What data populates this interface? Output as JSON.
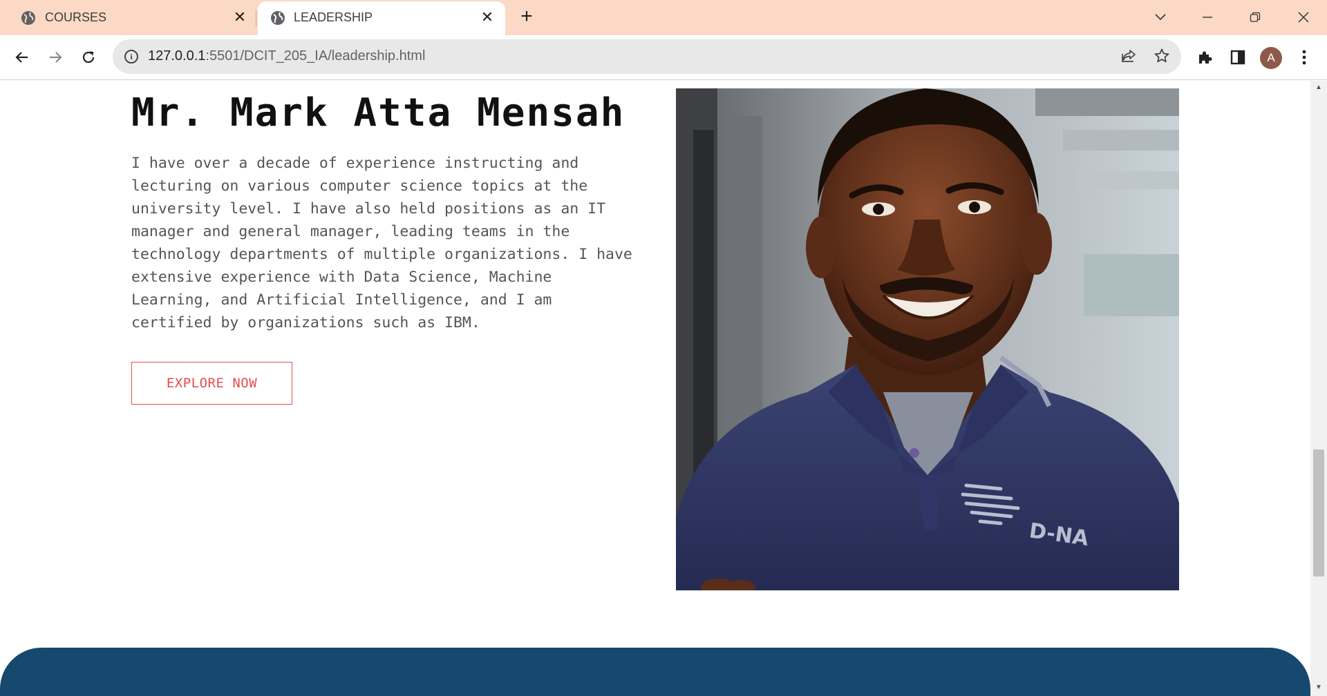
{
  "browser": {
    "tabs": [
      {
        "title": "COURSES",
        "active": false
      },
      {
        "title": "LEADERSHIP",
        "active": true
      }
    ],
    "new_tab_label": "+",
    "url_host": "127.0.0.1",
    "url_rest": ":5501/DCIT_205_IA/leadership.html",
    "profile_initial": "A"
  },
  "profile": {
    "name": "Mr. Mark Atta Mensah",
    "bio": "I have over a decade of experience instructing and lecturing on various computer science topics at the university level. I have also held positions as an IT manager and general manager, leading teams in the technology departments of multiple organizations. I have extensive experience with Data Science, Machine Learning, and Artificial Intelligence, and I am certified by organizations such as IBM.",
    "cta_label": "EXPLORE NOW",
    "shirt_logo": "D-NA"
  },
  "colors": {
    "tabbar_bg": "#fbd9c4",
    "accent_red": "#e74c4c",
    "footer_blue": "#17486d"
  }
}
